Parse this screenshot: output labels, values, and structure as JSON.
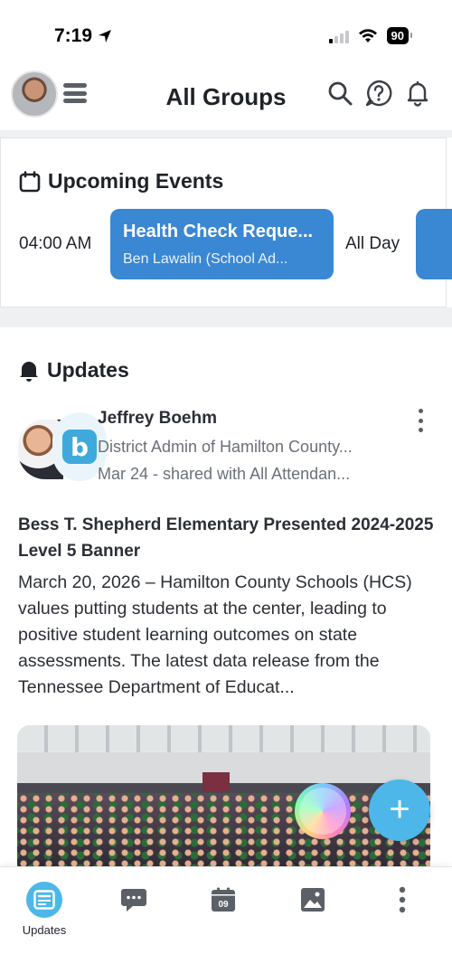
{
  "status_bar": {
    "time": "7:19",
    "battery": "90"
  },
  "header": {
    "title": "All Groups",
    "icons": [
      "avatar",
      "menu-icon",
      "search-icon",
      "help-icon",
      "bell-icon"
    ]
  },
  "upcoming_events": {
    "heading": "Upcoming Events",
    "events": [
      {
        "time": "04:00 AM",
        "title": "Health Check Reque...",
        "subtitle": "Ben Lawalin (School Ad...",
        "color": "#3a87d4"
      },
      {
        "time": "All Day",
        "color": "#3a87d4"
      }
    ]
  },
  "updates": {
    "heading": "Updates",
    "post": {
      "author": "Jeffrey Boehm",
      "role": "District Admin of Hamilton County...",
      "meta": "Mar 24 - shared with All Attendan...",
      "logo_letter": "b",
      "title": "Bess T. Shepherd Elementary Presented 2024-2025 Level 5 Banner",
      "body": "March 20, 2026 – Hamilton County Schools (HCS) values putting students at the center, leading to positive student learning outcomes on state assessments. The latest data release from the Tennessee Department of Educat..."
    }
  },
  "fab": {
    "label": "+"
  },
  "bottom_nav": {
    "items": [
      {
        "label": "Updates",
        "icon": "updates-icon",
        "active": true
      },
      {
        "label": "",
        "icon": "chat-icon",
        "active": false
      },
      {
        "label": "",
        "icon": "calendar-icon",
        "active": false,
        "date_text": "09"
      },
      {
        "label": "",
        "icon": "photos-icon",
        "active": false
      },
      {
        "label": "",
        "icon": "more-icon",
        "active": false
      }
    ]
  },
  "colors": {
    "accent": "#4cb7e8",
    "event_blue": "#3a87d4",
    "text_dark": "#1f2328",
    "text_muted": "#6b7078"
  }
}
